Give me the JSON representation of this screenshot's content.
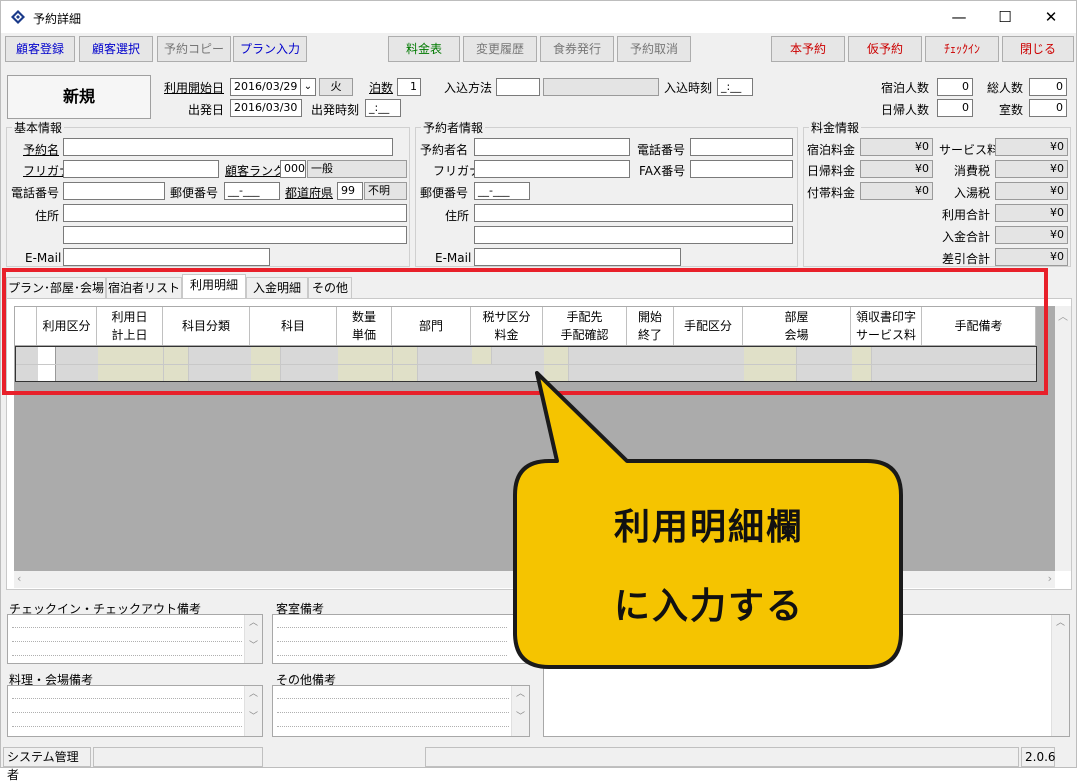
{
  "window": {
    "title": "予約詳細",
    "minimize": "—",
    "maximize": "☐",
    "close": "✕"
  },
  "toolbar": {
    "customer_register": "顧客登録",
    "customer_select": "顧客選択",
    "reservation_copy": "予約コピー",
    "plan_input": "プラン入力",
    "rate_table": "料金表",
    "change_history": "変更履歴",
    "meal_ticket": "食券発行",
    "cancel_reservation": "予約取消",
    "confirm_reservation": "本予約",
    "tentative_reservation": "仮予約",
    "checkin": "ﾁｪｯｸｲﾝ",
    "close": "閉じる"
  },
  "header": {
    "status": "新規",
    "start_date_label": "利用開始日",
    "start_date": "2016/03/29",
    "weekday": "火",
    "nights_label": "泊数",
    "nights": "1",
    "entry_method_label": "入込方法",
    "entry_method": "",
    "entry_method_name": "",
    "entry_time_label": "入込時刻",
    "entry_time": "_:__",
    "departure_date_label": "出発日",
    "departure_date": "2016/03/30",
    "departure_time_label": "出発時刻",
    "departure_time": "_:__",
    "guests_label": "宿泊人数",
    "guests": "0",
    "day_guests_label": "日帰人数",
    "day_guests": "0",
    "total_label": "総人数",
    "total": "0",
    "rooms_label": "室数",
    "rooms": "0"
  },
  "basic_info": {
    "title": "基本情報",
    "name_label": "予約名",
    "kana_label": "フリガナ",
    "rank_label": "顧客ランク",
    "rank_code": "000",
    "rank_name": "一般",
    "phone_label": "電話番号",
    "zip_label": "郵便番号",
    "zip": "__-___",
    "pref_label": "都道府県",
    "pref_code": "99",
    "pref_name": "不明",
    "address_label": "住所",
    "email_label": "E-Mail"
  },
  "booker_info": {
    "title": "予約者情報",
    "name_label": "予約者名",
    "phone_label": "電話番号",
    "kana_label": "フリガナ",
    "fax_label": "FAX番号",
    "zip_label": "郵便番号",
    "zip": "__-___",
    "address_label": "住所",
    "email_label": "E-Mail"
  },
  "rate_info": {
    "title": "料金情報",
    "stay_label": "宿泊料金",
    "stay": "¥0",
    "day_label": "日帰料金",
    "day": "¥0",
    "extra_label": "付帯料金",
    "extra": "¥0",
    "service_label": "サービス料",
    "service": "¥0",
    "tax_label": "消費税",
    "tax": "¥0",
    "bath_tax_label": "入湯税",
    "bath_tax": "¥0",
    "usage_total_label": "利用合計",
    "usage_total": "¥0",
    "payment_total_label": "入金合計",
    "payment_total": "¥0",
    "balance_label": "差引合計",
    "balance": "¥0"
  },
  "tabs": [
    {
      "label": "プラン･部屋･会場"
    },
    {
      "label": "宿泊者リスト"
    },
    {
      "label": "利用明細"
    },
    {
      "label": "入金明細"
    },
    {
      "label": "その他"
    }
  ],
  "grid_headers": {
    "usage_type": "利用区分",
    "usage_date": "利用日",
    "post_date": "計上日",
    "item_category": "科目分類",
    "item": "科目",
    "quantity": "数量",
    "unit_price": "単価",
    "department": "部門",
    "tax_type": "税サ区分",
    "charge": "料金",
    "supplier": "手配先",
    "arrangement_check": "手配確認",
    "start": "開始",
    "end": "終了",
    "arrangement_type": "手配区分",
    "room": "部屋",
    "venue": "会場",
    "receipt_print": "領収書印字",
    "service_fee": "サービス料",
    "arrangement_note": "手配備考"
  },
  "memos": {
    "checkin_note": "チェックイン・チェックアウト備考",
    "room_note": "客室備考",
    "meal_note": "料理・会場備考",
    "other_note": "その他備考"
  },
  "statusbar": {
    "user": "システム管理者",
    "version": "2.0.6"
  },
  "callout": {
    "line1": "利用明細欄",
    "line2": "に入力する"
  },
  "colors": {
    "highlight": "#e8202a",
    "callout": "#f5c400",
    "link_blue": "#0000cc"
  }
}
